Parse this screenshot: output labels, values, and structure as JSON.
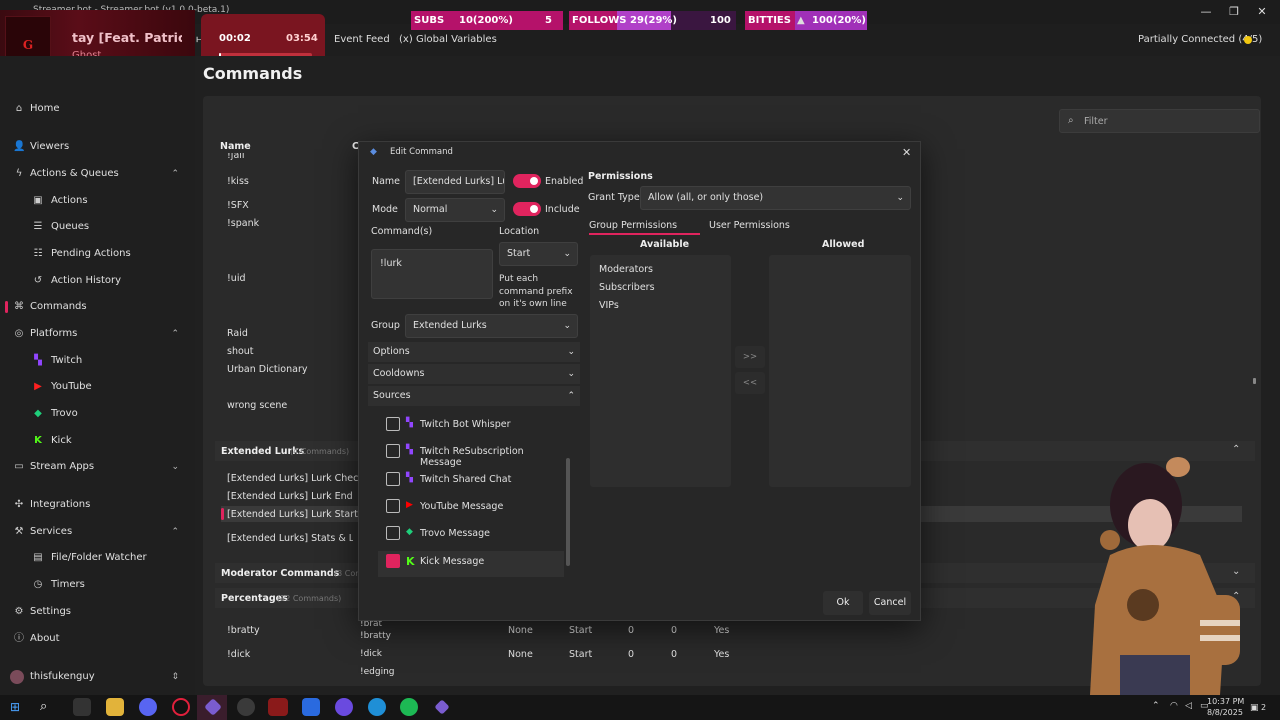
{
  "window": {
    "title": "Streamer.bot - Streamer.bot (v1.0.0-beta.1)"
  },
  "overlay": {
    "now_playing": {
      "title": "tay [Feat. Patrick \\",
      "artist": "Ghost",
      "elapsed": "00:02",
      "duration": "03:54"
    },
    "subs": {
      "label": "SUBS",
      "value": "10(200%)",
      "goal": "5"
    },
    "follows": {
      "label": "FOLLOWS",
      "value": "29(29%)",
      "goal": "100"
    },
    "bitties": {
      "label": "BITTIES",
      "value": "100(20%)"
    }
  },
  "toolbar": {
    "event_feed": "Event Feed",
    "global_variables": "Global Variables",
    "connection_status": "Partially Connected (4/5)"
  },
  "page": {
    "title": "Commands",
    "filter_placeholder": "Filter"
  },
  "sidebar": {
    "home": "Home",
    "viewers": "Viewers",
    "actions_queues": "Actions & Queues",
    "actions": "Actions",
    "queues": "Queues",
    "pending_actions": "Pending Actions",
    "action_history": "Action History",
    "commands": "Commands",
    "platforms": "Platforms",
    "twitch": "Twitch",
    "youtube": "YouTube",
    "trovo": "Trovo",
    "kick": "Kick",
    "stream_apps": "Stream Apps",
    "integrations": "Integrations",
    "services": "Services",
    "file_folder_watcher": "File/Folder Watcher",
    "timers": "Timers",
    "settings": "Settings",
    "about": "About",
    "user": "thisfukenguy"
  },
  "table": {
    "header_name": "Name",
    "names_top": [
      "!jail",
      "!kiss",
      "!SFX",
      "!spank",
      "!uid",
      "Raid",
      "shout",
      "Urban Dictionary",
      "wrong scene"
    ],
    "groups": [
      {
        "name": "Extended Lurks",
        "count": "(4 Commands)"
      },
      {
        "name": "Moderator Commands",
        "count": "(3 Commands)"
      },
      {
        "name": "Percentages",
        "count": "(12 Commands)"
      }
    ],
    "lurk_rows": [
      "[Extended Lurks] Lurk Check",
      "[Extended Lurks] Lurk End",
      "[Extended Lurks] Lurk Start",
      "[Extended Lurks] Stats & Leade"
    ],
    "pct_rows": [
      {
        "name": "!bratty",
        "cmd1": "!brat",
        "cmd2": "!bratty",
        "perm": "None",
        "loc": "Start",
        "c1": "0",
        "c2": "0",
        "enabled": "Yes"
      },
      {
        "name": "!dick",
        "cmd1": "!dick",
        "cmd2": "!edging",
        "perm": "None",
        "loc": "Start",
        "c1": "0",
        "c2": "0",
        "enabled": "Yes"
      }
    ]
  },
  "dialog": {
    "title": "Edit Command",
    "name_label": "Name",
    "name_value": "[Extended Lurks] Lurk",
    "enabled_label": "Enabled",
    "mode_label": "Mode",
    "mode_value": "Normal",
    "include_label": "Include",
    "commands_label": "Command(s)",
    "commands_value": "!lurk",
    "location_label": "Location",
    "location_value": "Start",
    "location_hint": "Put each command prefix on it's own line",
    "group_label": "Group",
    "group_value": "Extended Lurks",
    "options_label": "Options",
    "cooldowns_label": "Cooldowns",
    "sources_label": "Sources",
    "sources": [
      {
        "label": "Twitch Bot Whisper",
        "checked": false,
        "icon": "twitch-icon",
        "color": "#9146ff"
      },
      {
        "label": "Twitch ReSubscription Message",
        "checked": false,
        "icon": "twitch-icon",
        "color": "#9146ff"
      },
      {
        "label": "Twitch Shared Chat",
        "checked": false,
        "icon": "twitch-icon",
        "color": "#9146ff"
      },
      {
        "label": "YouTube Message",
        "checked": false,
        "icon": "youtube-icon",
        "color": "#ff0000"
      },
      {
        "label": "Trovo Message",
        "checked": false,
        "icon": "trovo-icon",
        "color": "#1fcf7b"
      },
      {
        "label": "Kick Message",
        "checked": true,
        "icon": "kick-icon",
        "color": "#53fc18"
      }
    ],
    "permissions_label": "Permissions",
    "grant_type_label": "Grant Type",
    "grant_type_value": "Allow (all, or only those)",
    "group_perms_tab": "Group Permissions",
    "user_perms_tab": "User Permissions",
    "available_label": "Available",
    "allowed_label": "Allowed",
    "available_items": [
      "Moderators",
      "Subscribers",
      "VIPs"
    ],
    "move_right": ">>",
    "move_left": "<<",
    "ok": "Ok",
    "cancel": "Cancel"
  },
  "taskbar": {
    "time": "10:37 PM",
    "date": "8/8/2025",
    "notifications": "2"
  },
  "colors": {
    "accent": "#e0245e",
    "subs_bar": "#b5126a",
    "follows_bar": "#b040c8",
    "bitties_bar": "#c040d0"
  }
}
